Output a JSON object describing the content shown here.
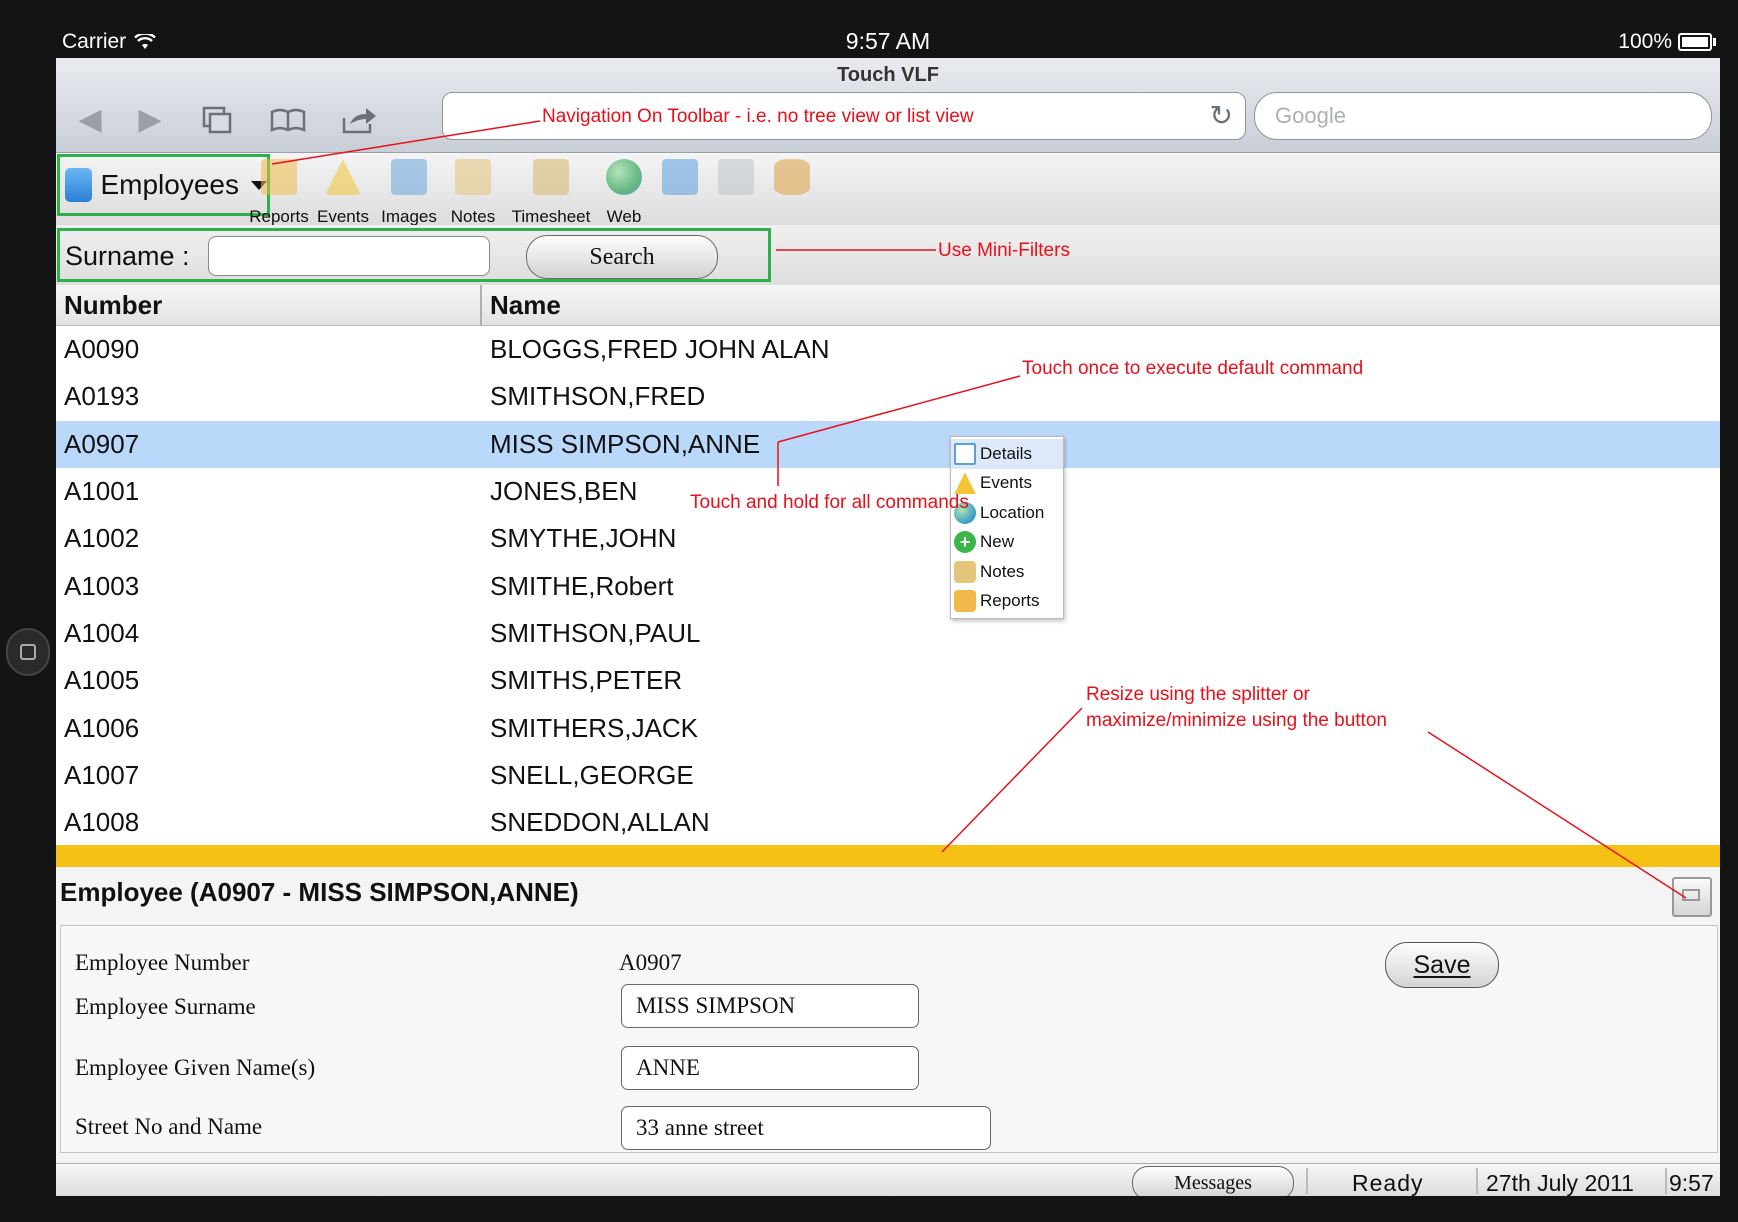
{
  "status_bar": {
    "carrier": "Carrier",
    "time": "9:57 AM",
    "battery": "100%"
  },
  "browser": {
    "title": "Touch VLF",
    "url": "",
    "search_placeholder": "Google",
    "nav_icons": [
      "back-arrow-icon",
      "forward-arrow-icon",
      "tabs-icon",
      "bookmarks-icon",
      "share-icon"
    ]
  },
  "toolbar": {
    "application": "Employees",
    "items": [
      {
        "label": "Reports",
        "icon": "reports-folder-icon",
        "color": "#f0b94a"
      },
      {
        "label": "Events",
        "icon": "warning-triangle-icon",
        "color": "#f3c63a"
      },
      {
        "label": "Images",
        "icon": "images-icon",
        "color": "#6aa6de"
      },
      {
        "label": "Notes",
        "icon": "notes-pencil-icon",
        "color": "#e4c57a"
      },
      {
        "label": "Timesheet",
        "icon": "timesheet-icon",
        "color": "#d8b46a"
      },
      {
        "label": "Web",
        "icon": "globe-icon",
        "color": "#3aa860"
      },
      {
        "label": "",
        "icon": "email-icon",
        "color": "#5aa0e0"
      },
      {
        "label": "",
        "icon": "document-gear-icon",
        "color": "#c0c4c8"
      },
      {
        "label": "",
        "icon": "database-arrow-icon",
        "color": "#e0a040"
      }
    ]
  },
  "filter": {
    "label": "Surname :",
    "value": "",
    "search_label": "Search"
  },
  "grid": {
    "columns": [
      "Number",
      "Name"
    ],
    "rows": [
      {
        "number": "A0090",
        "name": "BLOGGS,FRED JOHN ALAN"
      },
      {
        "number": "A0193",
        "name": "SMITHSON,FRED"
      },
      {
        "number": "A0907",
        "name": "MISS SIMPSON,ANNE"
      },
      {
        "number": "A1001",
        "name": "JONES,BEN"
      },
      {
        "number": "A1002",
        "name": "SMYTHE,JOHN"
      },
      {
        "number": "A1003",
        "name": "SMITHE,Robert"
      },
      {
        "number": "A1004",
        "name": "SMITHSON,PAUL"
      },
      {
        "number": "A1005",
        "name": "SMITHS,PETER"
      },
      {
        "number": "A1006",
        "name": "SMITHERS,JACK"
      },
      {
        "number": "A1007",
        "name": "SNELL,GEORGE"
      },
      {
        "number": "A1008",
        "name": "SNEDDON,ALLAN"
      }
    ],
    "selected_index": 2
  },
  "context_menu": [
    {
      "label": "Details",
      "icon": "details-window-icon",
      "color": "#5aa0e0"
    },
    {
      "label": "Events",
      "icon": "warning-triangle-icon",
      "color": "#f3c63a"
    },
    {
      "label": "Location",
      "icon": "globe-search-icon",
      "color": "#3a9ac8"
    },
    {
      "label": "New",
      "icon": "plus-circle-icon",
      "color": "#3bb54a"
    },
    {
      "label": "Notes",
      "icon": "notes-pencil-icon",
      "color": "#e4c57a"
    },
    {
      "label": "Reports",
      "icon": "reports-folder-icon",
      "color": "#f0b94a"
    }
  ],
  "detail": {
    "header": "Employee (A0907 - MISS SIMPSON,ANNE)",
    "save_label": "Save",
    "fields": {
      "number_label": "Employee Number",
      "number_value": "A0907",
      "surname_label": "Employee Surname",
      "surname_value": "MISS SIMPSON",
      "given_label": "Employee Given Name(s)",
      "given_value": "ANNE",
      "street_label": "Street No and Name",
      "street_value": "33 anne street"
    }
  },
  "bottom_bar": {
    "messages_label": "Messages",
    "status": "Ready",
    "date": "27th July 2011",
    "time": "9:57"
  },
  "annotations": {
    "nav_toolbar": "Navigation On Toolbar - i.e. no tree view or list view",
    "mini_filters": "Use Mini-Filters",
    "touch_once": "Touch once to execute default command",
    "touch_hold": "Touch and hold for all commands",
    "resize_1": "Resize using the splitter or",
    "resize_2": "maximize/minimize using the button"
  },
  "colors": {
    "highlight_box": "#2eb04a",
    "splitter": "#f6c015",
    "selected_row": "#bad8fa",
    "annotation": "#e8101a"
  }
}
